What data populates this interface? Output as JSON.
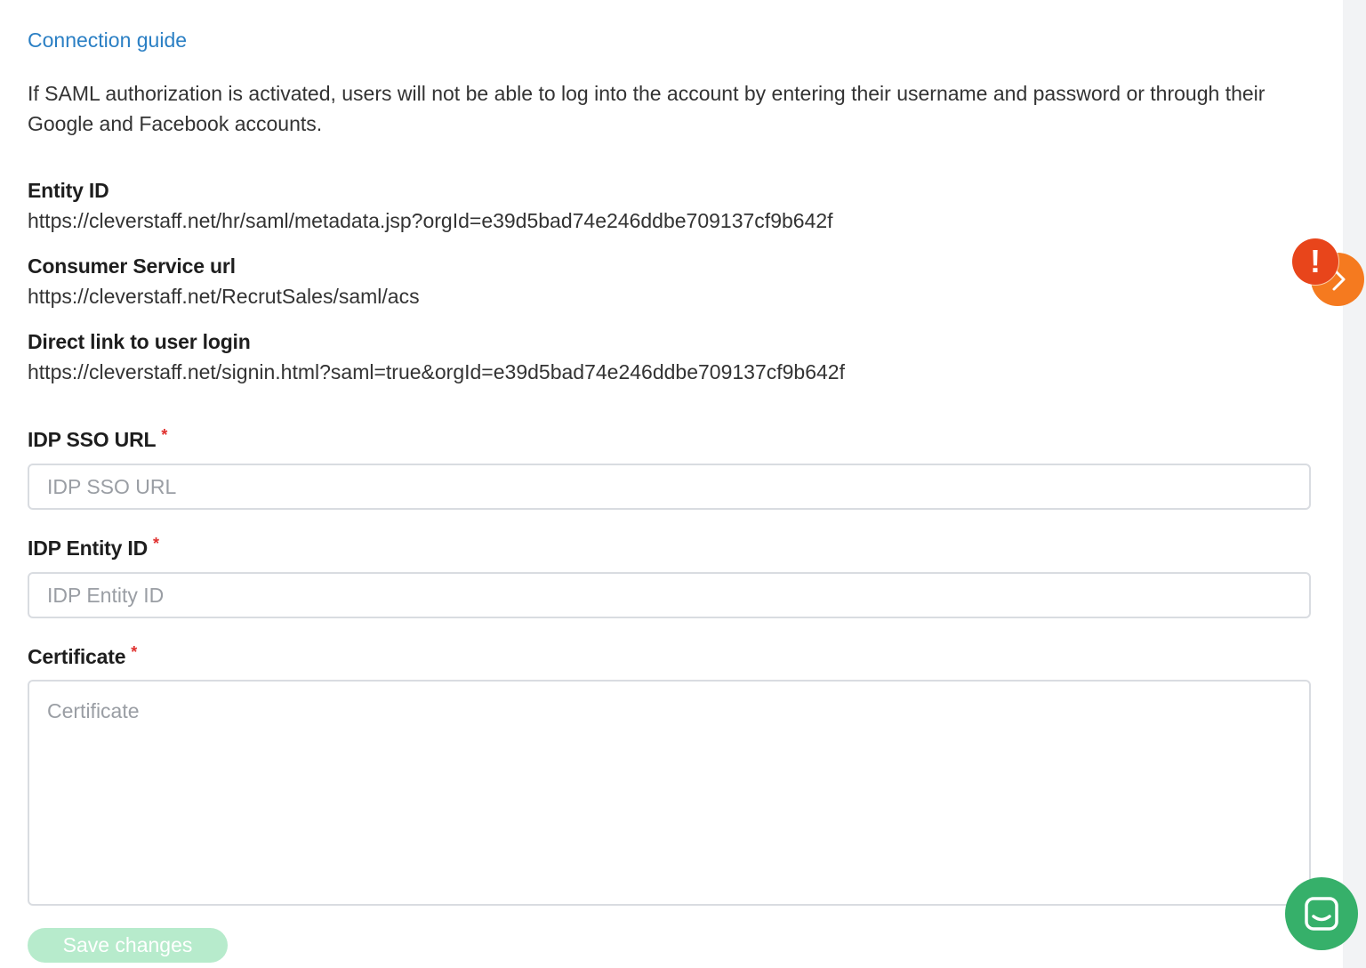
{
  "guide": {
    "link_label": "Connection guide"
  },
  "intro_text": "If SAML authorization is activated, users will not be able to log into the account by entering their username and password or through their Google and Facebook accounts.",
  "info": [
    {
      "label": "Entity ID",
      "value": "https://cleverstaff.net/hr/saml/metadata.jsp?orgId=e39d5bad74e246ddbe709137cf9b642f"
    },
    {
      "label": "Consumer Service url",
      "value": "https://cleverstaff.net/RecrutSales/saml/acs"
    },
    {
      "label": "Direct link to user login",
      "value": "https://cleverstaff.net/signin.html?saml=true&orgId=e39d5bad74e246ddbe709137cf9b642f"
    }
  ],
  "form": {
    "idp_sso_url": {
      "label": "IDP SSO URL",
      "required_mark": "*",
      "placeholder": "IDP SSO URL",
      "value": ""
    },
    "idp_entity_id": {
      "label": "IDP Entity ID",
      "required_mark": "*",
      "placeholder": "IDP Entity ID",
      "value": ""
    },
    "certificate": {
      "label": "Certificate",
      "required_mark": "*",
      "placeholder": "Certificate",
      "value": ""
    },
    "save_label": "Save changes"
  },
  "widgets": {
    "alert_badge": "!",
    "side_toggle_icon": "chevron-right-icon",
    "chat_icon": "chat-icon"
  },
  "colors": {
    "link": "#2a7fc4",
    "required": "#e0312f",
    "save_button_disabled": "#b7ebcc",
    "side_toggle": "#f57a1f",
    "alert": "#e8451b",
    "chat": "#36b06a"
  }
}
